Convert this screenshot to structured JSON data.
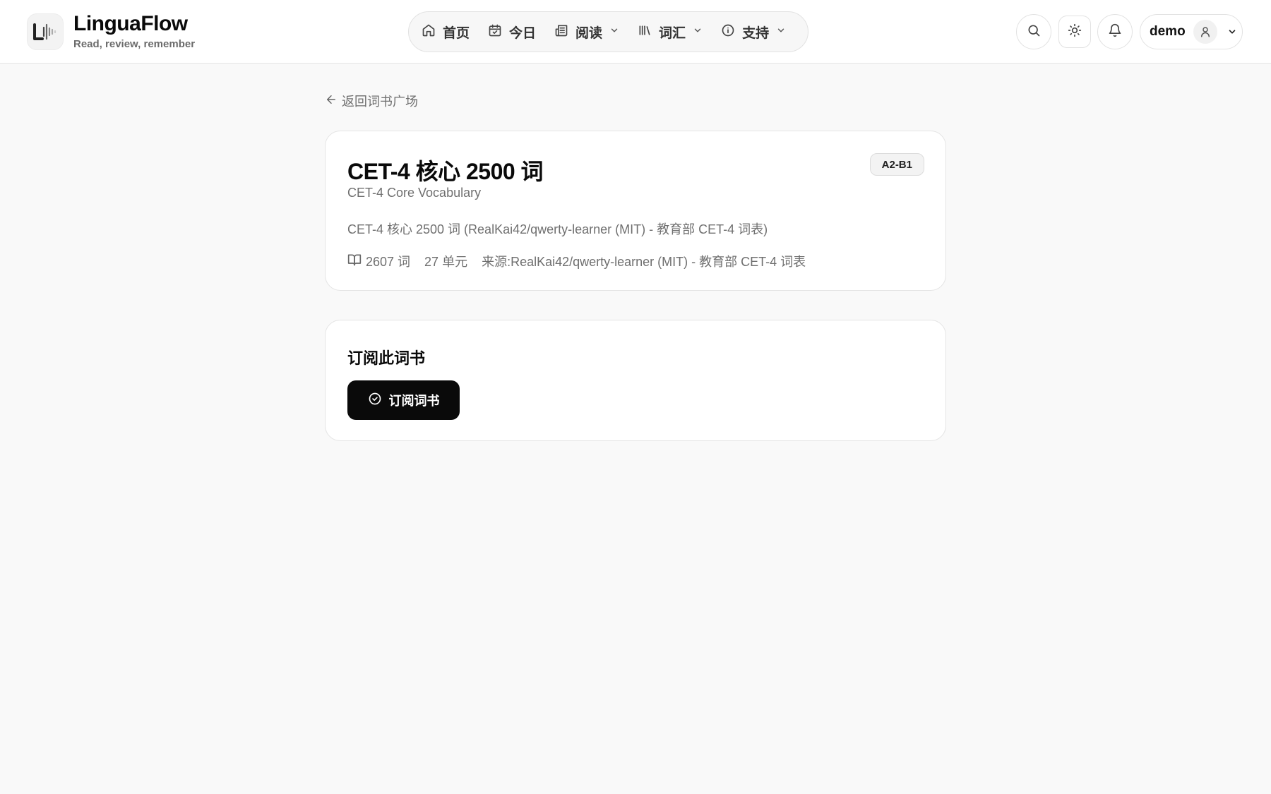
{
  "header": {
    "brand_title": "LinguaFlow",
    "brand_subtitle": "Read, review, remember",
    "nav": [
      {
        "label": "首页",
        "icon": "home-icon"
      },
      {
        "label": "今日",
        "icon": "calendar-check-icon"
      },
      {
        "label": "阅读",
        "icon": "newspaper-icon",
        "has_dropdown": true
      },
      {
        "label": "词汇",
        "icon": "library-icon",
        "has_dropdown": true
      },
      {
        "label": "支持",
        "icon": "info-icon",
        "has_dropdown": true
      }
    ],
    "user_name": "demo"
  },
  "back_link": "返回词书广场",
  "book": {
    "title": "CET-4 核心 2500 词",
    "level": "A2-B1",
    "subtitle_en": "CET-4 Core Vocabulary",
    "description": "CET-4 核心 2500 词 (RealKai42/qwerty-learner (MIT) - 教育部 CET-4 词表)",
    "word_count": "2607 词",
    "unit_count": "27 单元",
    "source": "来源:RealKai42/qwerty-learner (MIT) - 教育部 CET-4 词表"
  },
  "subscribe": {
    "heading": "订阅此词书",
    "button_label": "订阅词书"
  },
  "colors": {
    "page_bg": "#f9f9f9",
    "primary_button": "#0a0a0a",
    "muted_text": "#6f6f6f"
  }
}
